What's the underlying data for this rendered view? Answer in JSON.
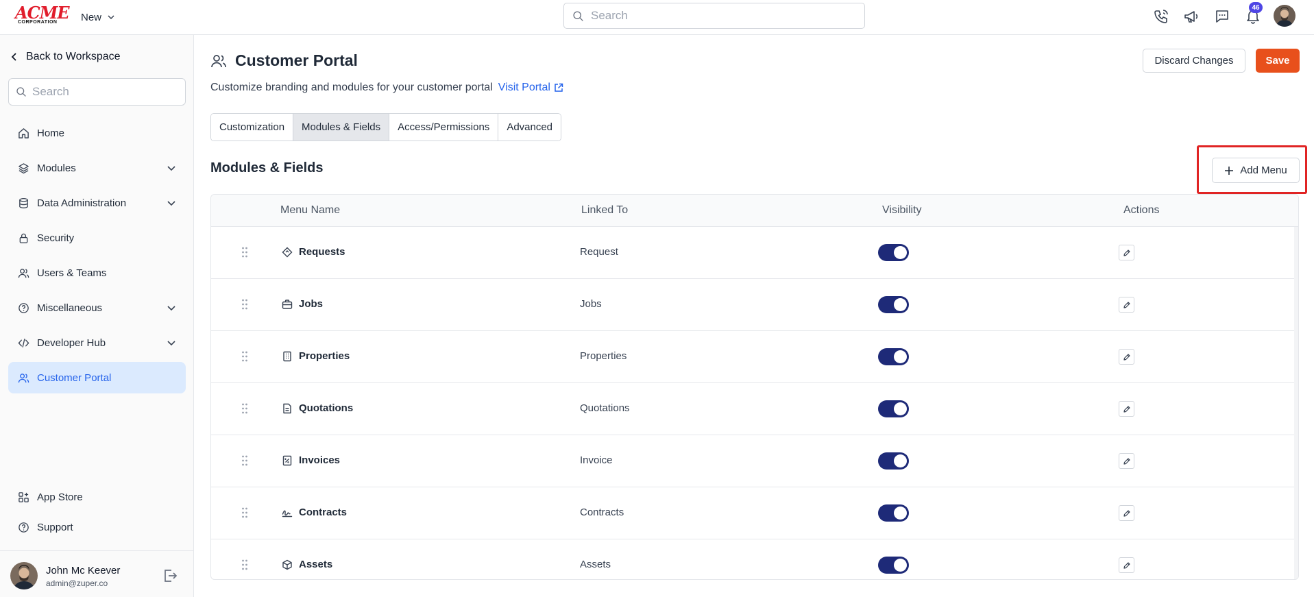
{
  "header": {
    "logo_text": "ACME",
    "logo_subtext": "CORPORATION",
    "new_label": "New",
    "search_placeholder": "Search",
    "notification_count": "46"
  },
  "sidebar": {
    "back_label": "Back to Workspace",
    "search_placeholder": "Search",
    "items": [
      {
        "label": "Home",
        "icon": "home-icon"
      },
      {
        "label": "Modules",
        "icon": "layers-icon",
        "expandable": true
      },
      {
        "label": "Data Administration",
        "icon": "database-icon",
        "expandable": true
      },
      {
        "label": "Security",
        "icon": "lock-icon"
      },
      {
        "label": "Users & Teams",
        "icon": "users-icon"
      },
      {
        "label": "Miscellaneous",
        "icon": "help-circle-icon",
        "expandable": true
      },
      {
        "label": "Developer Hub",
        "icon": "code-icon",
        "expandable": true
      },
      {
        "label": "Customer Portal",
        "icon": "users-icon",
        "active": true
      }
    ],
    "bottom_items": [
      {
        "label": "App Store",
        "icon": "app-grid-icon"
      },
      {
        "label": "Support",
        "icon": "help-circle-icon"
      }
    ],
    "user": {
      "name": "John Mc Keever",
      "email": "admin@zuper.co"
    }
  },
  "main": {
    "title": "Customer Portal",
    "subtitle": "Customize branding and modules for your customer portal",
    "visit_link": "Visit Portal",
    "discard_label": "Discard Changes",
    "save_label": "Save",
    "tabs": [
      {
        "label": "Customization"
      },
      {
        "label": "Modules & Fields",
        "active": true
      },
      {
        "label": "Access/Permissions"
      },
      {
        "label": "Advanced"
      }
    ],
    "section_title": "Modules & Fields",
    "add_menu_label": "Add Menu",
    "table": {
      "columns": [
        "Menu Name",
        "Linked To",
        "Visibility",
        "Actions"
      ],
      "rows": [
        {
          "name": "Requests",
          "linked": "Request",
          "icon": "diamond-icon",
          "visible": true
        },
        {
          "name": "Jobs",
          "linked": "Jobs",
          "icon": "briefcase-icon",
          "visible": true
        },
        {
          "name": "Properties",
          "linked": "Properties",
          "icon": "building-icon",
          "visible": true
        },
        {
          "name": "Quotations",
          "linked": "Quotations",
          "icon": "document-icon",
          "visible": true
        },
        {
          "name": "Invoices",
          "linked": "Invoice",
          "icon": "receipt-icon",
          "visible": true
        },
        {
          "name": "Contracts",
          "linked": "Contracts",
          "icon": "signature-icon",
          "visible": true
        },
        {
          "name": "Assets",
          "linked": "Assets",
          "icon": "cube-icon",
          "visible": true
        }
      ]
    }
  },
  "colors": {
    "accent": "#e8501c",
    "active_nav_bg": "#dbeafe",
    "active_nav_text": "#2563eb",
    "toggle_on": "#1e2a78",
    "highlight_border": "#e02424",
    "link": "#2563eb"
  }
}
